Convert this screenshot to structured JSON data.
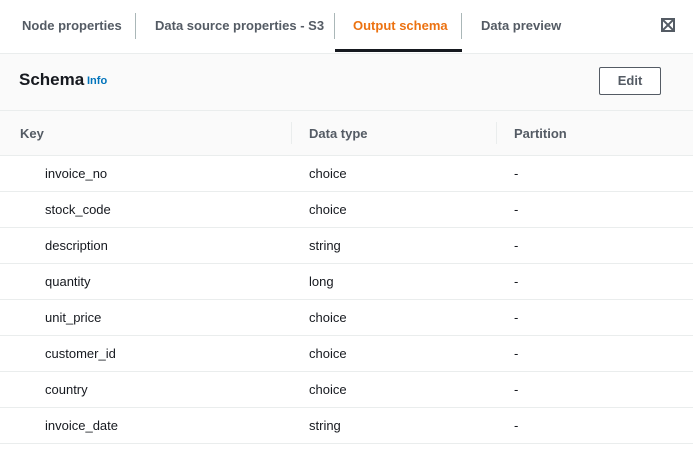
{
  "tabs": [
    {
      "label": "Node properties",
      "active": false
    },
    {
      "label": "Data source properties - S3",
      "active": false
    },
    {
      "label": "Output schema",
      "active": true
    },
    {
      "label": "Data preview",
      "active": false
    }
  ],
  "header": {
    "title": "Schema",
    "info_label": "Info",
    "edit_label": "Edit"
  },
  "table": {
    "columns": [
      "Key",
      "Data type",
      "Partition"
    ],
    "rows": [
      {
        "key": "invoice_no",
        "type": "choice",
        "partition": "-"
      },
      {
        "key": "stock_code",
        "type": "choice",
        "partition": "-"
      },
      {
        "key": "description",
        "type": "string",
        "partition": "-"
      },
      {
        "key": "quantity",
        "type": "long",
        "partition": "-"
      },
      {
        "key": "unit_price",
        "type": "choice",
        "partition": "-"
      },
      {
        "key": "customer_id",
        "type": "choice",
        "partition": "-"
      },
      {
        "key": "country",
        "type": "choice",
        "partition": "-"
      },
      {
        "key": "invoice_date",
        "type": "string",
        "partition": "-"
      }
    ]
  },
  "colors": {
    "accent": "#ec7211",
    "link": "#0073bb",
    "text": "#16191f",
    "muted": "#545b64"
  },
  "icons": {
    "expand": "expand-icon"
  }
}
